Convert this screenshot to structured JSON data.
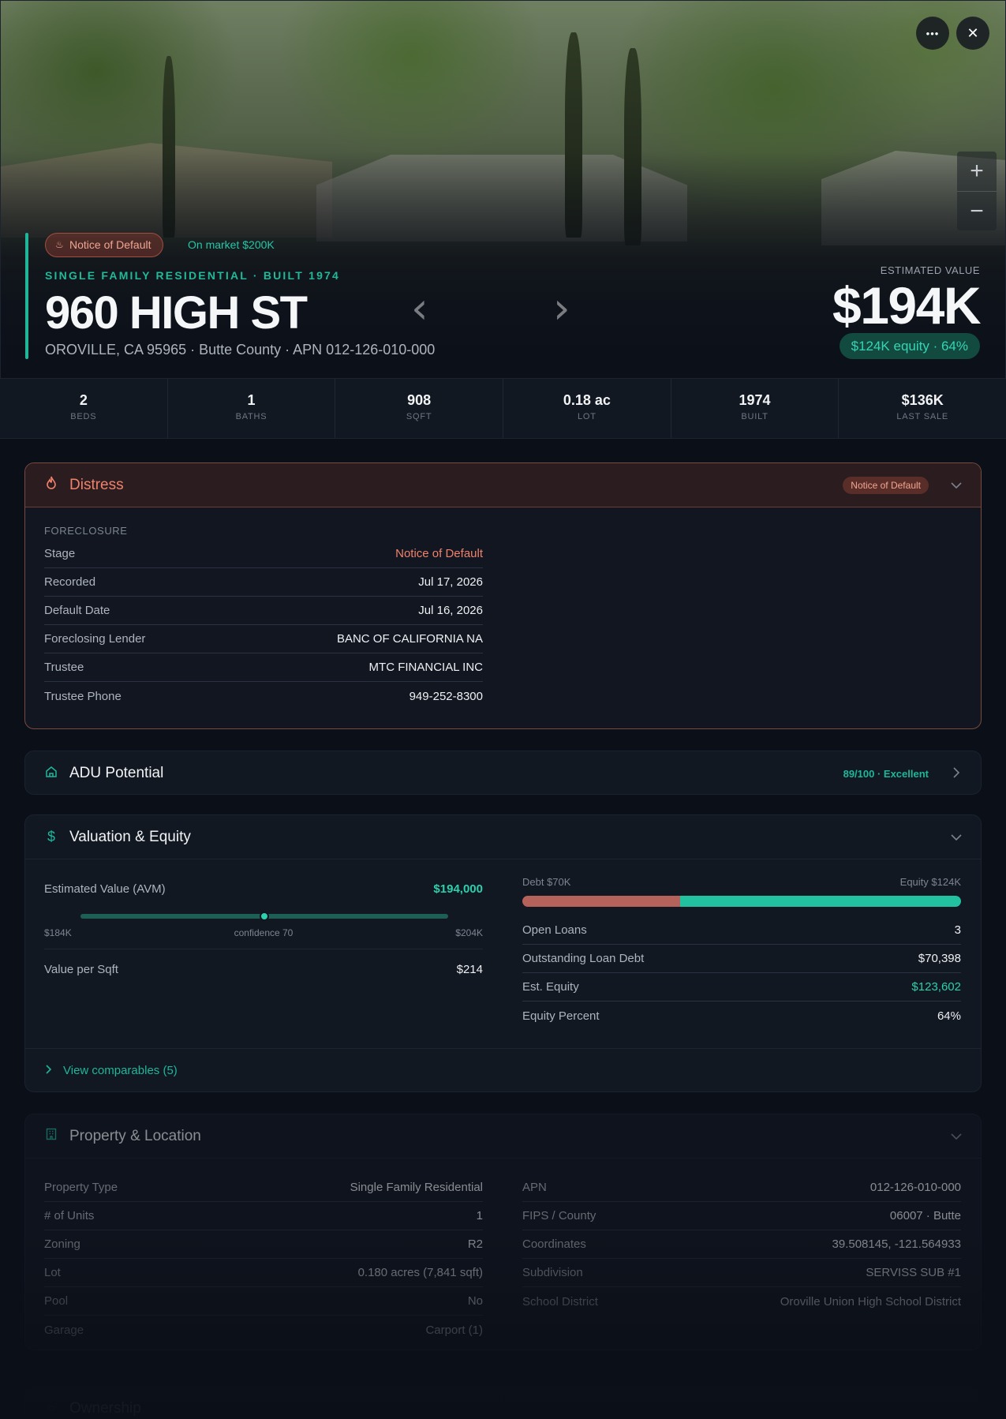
{
  "hero": {
    "badge": "Notice of Default",
    "on_market": "On market $200K",
    "property_line": "SINGLE FAMILY RESIDENTIAL · BUILT 1974",
    "address": "960 HIGH ST",
    "subaddress": "OROVILLE, CA 95965 · Butte County · APN 012-126-010-000",
    "est_label": "ESTIMATED VALUE",
    "est_value": "$194K",
    "equity_pill": "$124K equity · 64%",
    "more_glyph": "•••",
    "close_glyph": "✕",
    "zoom_in": "+",
    "zoom_out": "−",
    "prev_glyph": "‹",
    "next_glyph": "›"
  },
  "stats": [
    {
      "value": "2",
      "label": "BEDS"
    },
    {
      "value": "1",
      "label": "BATHS"
    },
    {
      "value": "908",
      "label": "SQFT"
    },
    {
      "value": "0.18 ac",
      "label": "LOT"
    },
    {
      "value": "1974",
      "label": "BUILT"
    },
    {
      "value": "$136K",
      "label": "LAST SALE"
    }
  ],
  "distress": {
    "title": "Distress",
    "badge": "Notice of Default",
    "section": "FORECLOSURE",
    "rows": [
      {
        "k": "Stage",
        "v": "Notice of Default"
      },
      {
        "k": "Recorded",
        "v": "Jul 17, 2026"
      },
      {
        "k": "Default Date",
        "v": "Jul 16, 2026"
      },
      {
        "k": "Foreclosing Lender",
        "v": "BANC OF CALIFORNIA NA"
      },
      {
        "k": "Trustee",
        "v": "MTC FINANCIAL INC"
      },
      {
        "k": "Trustee Phone",
        "v": "949-252-8300"
      }
    ]
  },
  "adu": {
    "title": "ADU Potential",
    "score": "89/100 · Excellent"
  },
  "valuation": {
    "title": "Valuation & Equity",
    "avm_label": "Estimated Value (AVM)",
    "avm_value": "$194,000",
    "range_low": "$184K",
    "range_high": "$204K",
    "confidence": "confidence 70",
    "value_per_sqft_label": "Value per Sqft",
    "value_per_sqft": "$214",
    "debt_label": "Debt $70K",
    "equity_label": "Equity $124K",
    "debt_fraction": 0.36,
    "right_rows": [
      {
        "k": "Open Loans",
        "v": "3"
      },
      {
        "k": "Outstanding Loan Debt",
        "v": "$70,398"
      },
      {
        "k": "Est. Equity",
        "v": "$123,602"
      },
      {
        "k": "Equity Percent",
        "v": "64%"
      }
    ],
    "comps": "View comparables (5)"
  },
  "property": {
    "title": "Property & Location",
    "left": [
      {
        "k": "Property Type",
        "v": "Single Family Residential"
      },
      {
        "k": "# of Units",
        "v": "1"
      },
      {
        "k": "Zoning",
        "v": "R2"
      },
      {
        "k": "Lot",
        "v": "0.180 acres (7,841 sqft)"
      },
      {
        "k": "Pool",
        "v": "No"
      },
      {
        "k": "Garage",
        "v": "Carport (1)"
      }
    ],
    "right": [
      {
        "k": "APN",
        "v": "012-126-010-000"
      },
      {
        "k": "FIPS / County",
        "v": "06007 · Butte"
      },
      {
        "k": "Coordinates",
        "v": "39.508145, -121.564933"
      },
      {
        "k": "Subdivision",
        "v": "SERVISS SUB #1"
      },
      {
        "k": "School District",
        "v": "Oroville Union High School District"
      }
    ]
  },
  "ownership": {
    "title": "Ownership"
  },
  "colors": {
    "accent": "#1fb69a",
    "distress": "#f0826b",
    "debt_bar": "#b5635a",
    "equity_bar": "#22c1a0"
  }
}
